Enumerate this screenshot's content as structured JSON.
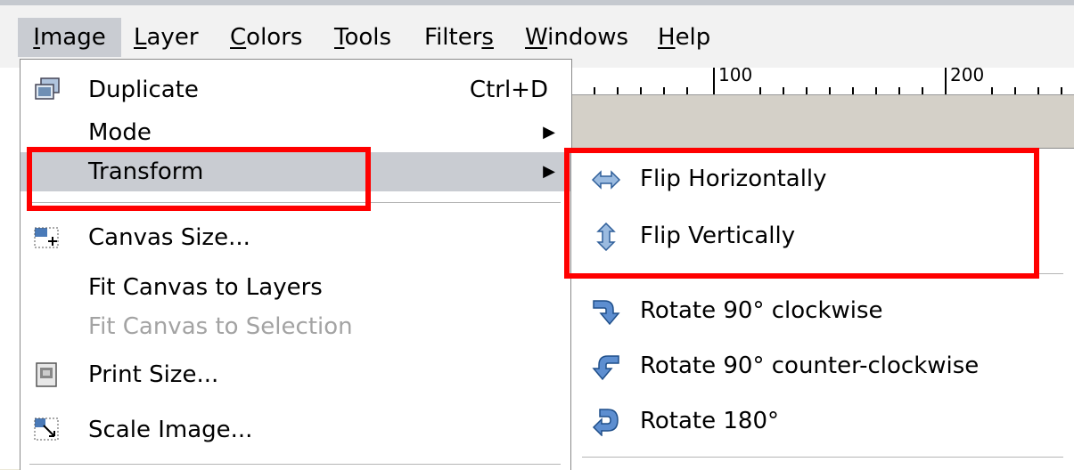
{
  "menubar": {
    "items": [
      {
        "label": "Image",
        "mnemonic": "I"
      },
      {
        "label": "Layer",
        "mnemonic": "L"
      },
      {
        "label": "Colors",
        "mnemonic": "C"
      },
      {
        "label": "Tools",
        "mnemonic": "T"
      },
      {
        "label": "Filters",
        "mnemonic": "s"
      },
      {
        "label": "Windows",
        "mnemonic": "W"
      },
      {
        "label": "Help",
        "mnemonic": "H"
      }
    ]
  },
  "ruler": {
    "labels": [
      "100",
      "200"
    ]
  },
  "image_menu": {
    "items": [
      {
        "label": "Duplicate",
        "shortcut": "Ctrl+D",
        "icon": "duplicate-icon"
      },
      {
        "label": "Mode",
        "submenu": true
      },
      {
        "label": "Transform",
        "submenu": true,
        "highlighted": true
      },
      {
        "label": "Canvas Size...",
        "icon": "canvas-size-icon"
      },
      {
        "label": "Fit Canvas to Layers"
      },
      {
        "label": "Fit Canvas to Selection",
        "disabled": true
      },
      {
        "label": "Print Size...",
        "icon": "print-size-icon"
      },
      {
        "label": "Scale Image...",
        "icon": "scale-image-icon"
      }
    ]
  },
  "transform_submenu": {
    "items": [
      {
        "label": "Flip Horizontally",
        "icon": "flip-horizontal-icon"
      },
      {
        "label": "Flip Vertically",
        "icon": "flip-vertical-icon"
      },
      {
        "label": "Rotate 90° clockwise",
        "icon": "rotate-cw-icon"
      },
      {
        "label": "Rotate 90° counter-clockwise",
        "icon": "rotate-ccw-icon"
      },
      {
        "label": "Rotate 180°",
        "icon": "rotate-180-icon"
      }
    ]
  },
  "annotations": {
    "highlight_color": "#ff0000",
    "menu_hover_color": "#c9ccd2"
  }
}
